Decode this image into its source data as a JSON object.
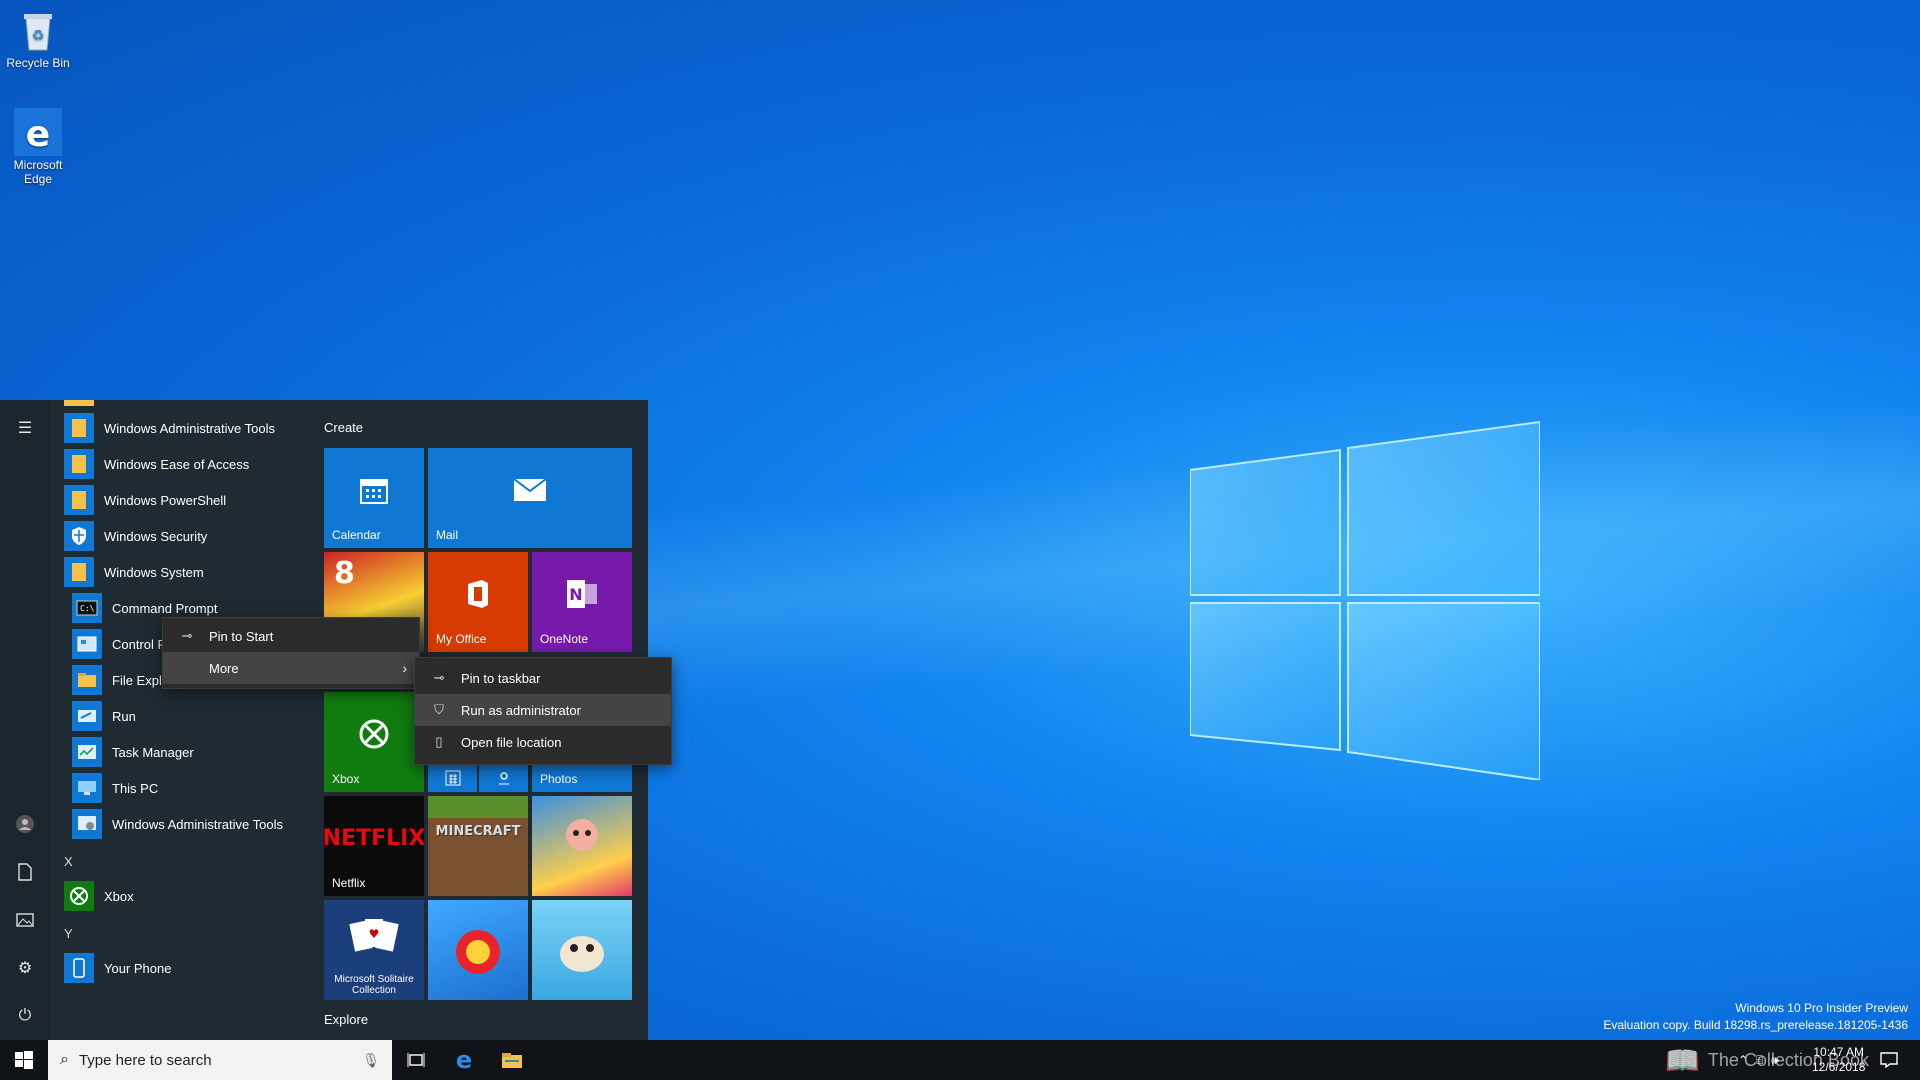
{
  "desktop": {
    "icons": [
      {
        "label": "Recycle Bin"
      },
      {
        "label": "Microsoft Edge"
      }
    ],
    "watermark": {
      "line1": "Windows 10 Pro Insider Preview",
      "line2": "Evaluation copy. Build 18298.rs_prerelease.181205-1436"
    },
    "brand_overlay": "The Collection Book"
  },
  "start_menu": {
    "apps": [
      {
        "label": "Windows Administrative Tools",
        "expandable": true
      },
      {
        "label": "Windows Ease of Access",
        "expandable": true
      },
      {
        "label": "Windows PowerShell",
        "expandable": true
      },
      {
        "label": "Windows Security"
      },
      {
        "label": "Windows System",
        "expanded": true
      }
    ],
    "system_apps": [
      {
        "label": "Command Prompt"
      },
      {
        "label": "Control P"
      },
      {
        "label": "File Explo"
      },
      {
        "label": "Run"
      },
      {
        "label": "Task Manager"
      },
      {
        "label": "This PC"
      },
      {
        "label": "Windows Administrative Tools"
      }
    ],
    "letter_x": "X",
    "xbox_app": "Xbox",
    "letter_y": "Y",
    "your_phone_app": "Your Phone",
    "groups": {
      "create": "Create",
      "explore": "Explore"
    },
    "tiles": {
      "calendar": "Calendar",
      "mail": "Mail",
      "my_office": "My Office",
      "onenote": "OneNote",
      "xbox": "Xbox",
      "photos": "Photos",
      "netflix": "Netflix",
      "netflix_logo": "NETFLIX",
      "minecraft_logo": "MINECRAFT",
      "solitaire": "Microsoft Solitaire Collection"
    }
  },
  "context_menu": {
    "pin_to_start": "Pin to Start",
    "more": "More"
  },
  "submenu": {
    "pin_to_taskbar": "Pin to taskbar",
    "run_as_admin": "Run as administrator",
    "open_file_location": "Open file location"
  },
  "taskbar": {
    "search_placeholder": "Type here to search",
    "time": "10:47 AM",
    "date": "12/6/2018"
  },
  "colors": {
    "accent": "#0f78d4",
    "office": "#d83b01",
    "onenote": "#7719aa",
    "xbox": "#107c10"
  }
}
